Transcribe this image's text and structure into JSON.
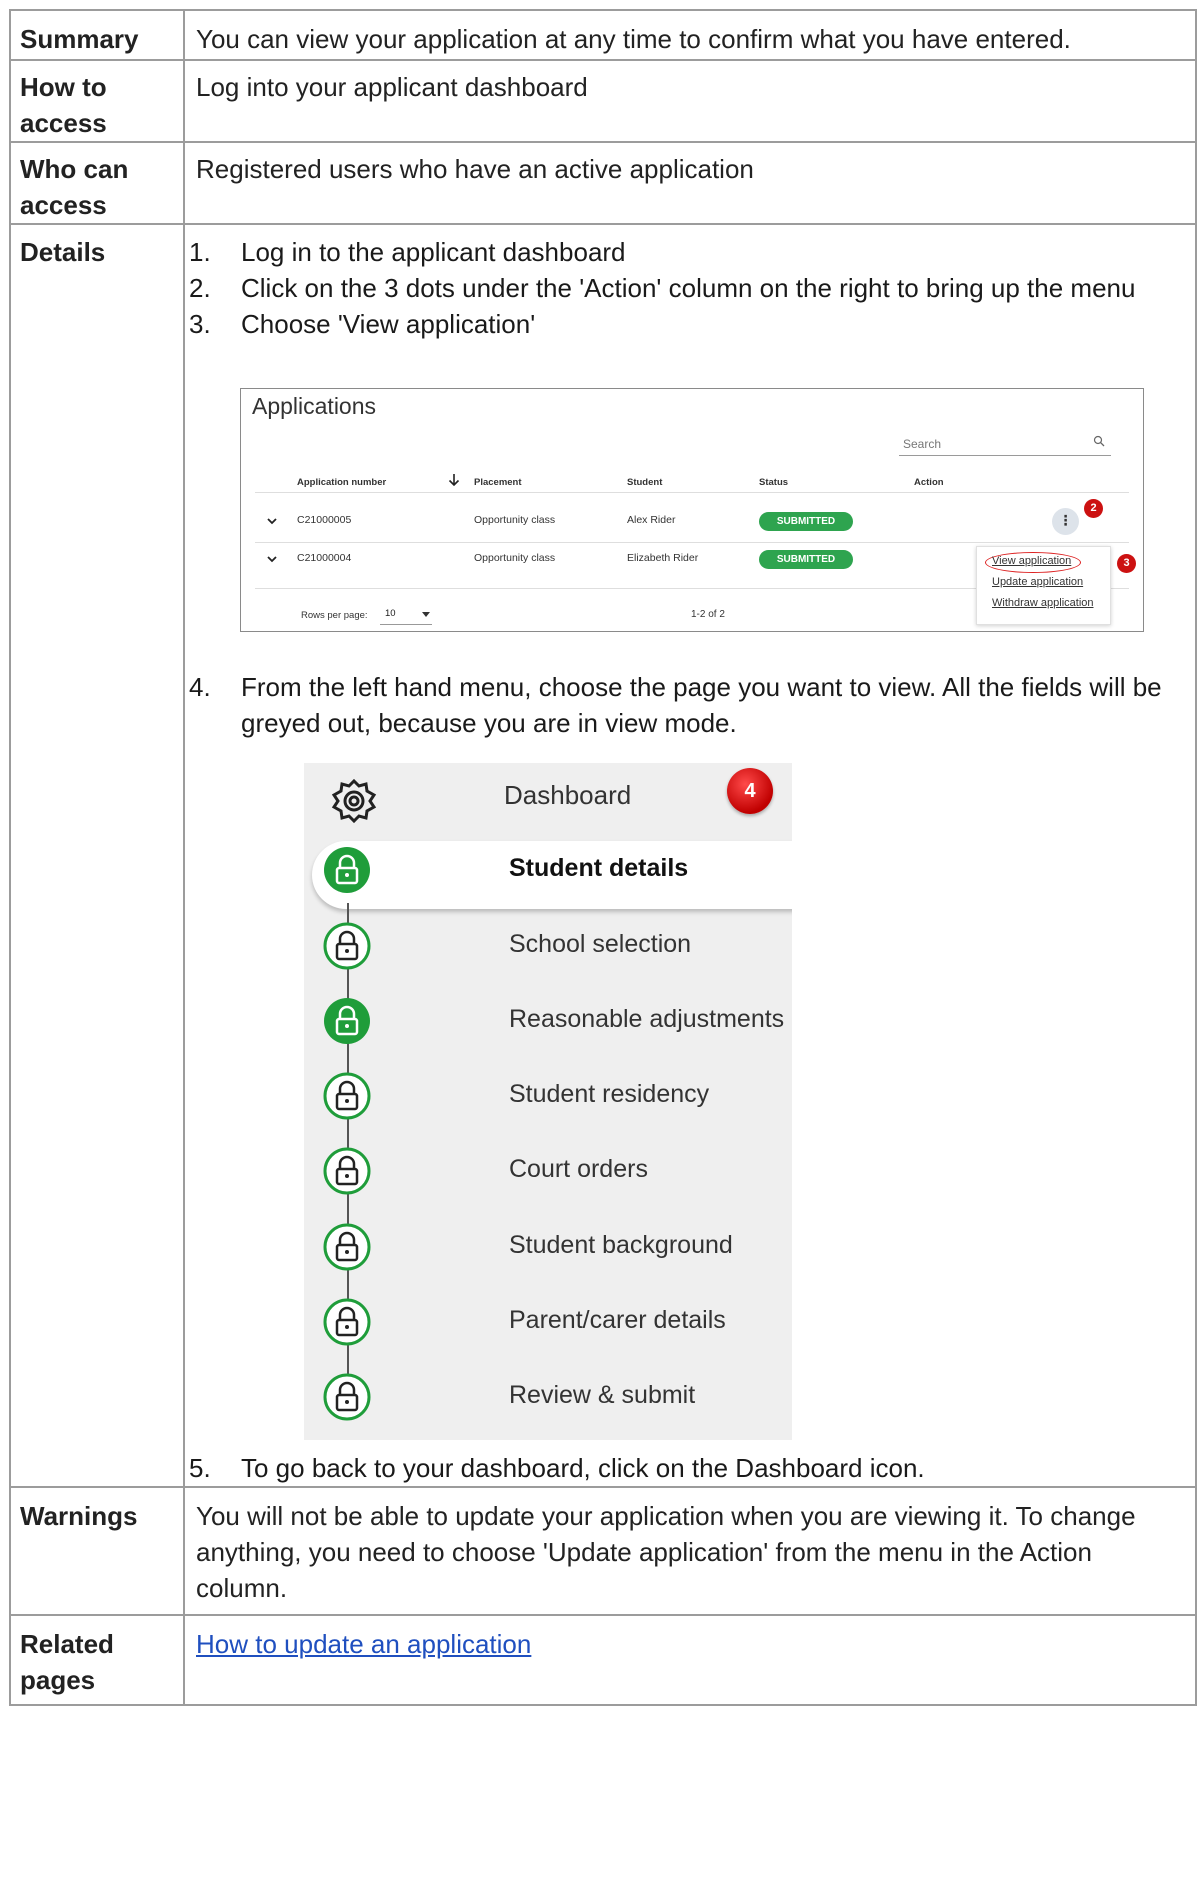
{
  "summary": {
    "label": "Summary",
    "text": "You can view your application at any time to confirm what you have entered."
  },
  "how_to_access": {
    "label": "How to access",
    "text": "Log into your applicant dashboard"
  },
  "who_can_access": {
    "label": "Who can access",
    "text": "Registered users who have an active application"
  },
  "details": {
    "label": "Details",
    "steps": [
      {
        "num": "1.",
        "text": "Log in to the applicant dashboard"
      },
      {
        "num": "2.",
        "text": "Click on the 3 dots under the 'Action' column on the right to bring up the menu"
      },
      {
        "num": "3.",
        "text": "Choose 'View application'"
      },
      {
        "num": "4.",
        "text": "From the left hand menu, choose the page you want to view. All the fields will be greyed out, because you are in view mode."
      },
      {
        "num": "5.",
        "text": "To go back to your dashboard, click on the Dashboard icon."
      }
    ]
  },
  "applications_screenshot": {
    "title": "Applications",
    "search_placeholder": "Search",
    "columns": [
      "Application number",
      "Placement",
      "Student",
      "Status",
      "Action"
    ],
    "rows": [
      {
        "number": "C21000005",
        "placement": "Opportunity class",
        "student": "Alex Rider",
        "status": "SUBMITTED"
      },
      {
        "number": "C21000004",
        "placement": "Opportunity class",
        "student": "Elizabeth Rider",
        "status": "SUBMITTED"
      }
    ],
    "action_dots": "⋮",
    "menu": [
      "View application",
      "Update application",
      "Withdraw application"
    ],
    "rows_per_page_label": "Rows per page:",
    "rows_per_page_value": "10",
    "pagination": "1-2 of 2",
    "markers": [
      "2",
      "3"
    ],
    "colors": {
      "submitted": "#2ea44f",
      "marker": "#cc1111"
    }
  },
  "nav_screenshot": {
    "dashboard_label": "Dashboard",
    "marker": "4",
    "items": [
      {
        "label": "Student details",
        "active": true,
        "filled": true
      },
      {
        "label": "School selection",
        "active": false,
        "filled": false
      },
      {
        "label": "Reasonable adjustments",
        "active": false,
        "filled": true
      },
      {
        "label": "Student residency",
        "active": false,
        "filled": false
      },
      {
        "label": "Court orders",
        "active": false,
        "filled": false
      },
      {
        "label": "Student background",
        "active": false,
        "filled": false
      },
      {
        "label": "Parent/carer details",
        "active": false,
        "filled": false
      },
      {
        "label": "Review & submit",
        "active": false,
        "filled": false
      }
    ],
    "icons": {
      "dashboard": "gear-icon",
      "step": "lock-icon"
    },
    "colors": {
      "green": "#1f9d3a"
    }
  },
  "warnings": {
    "label": "Warnings",
    "text": "You will not be able to update your application when you are viewing it. To change anything, you need to choose 'Update application' from the menu in the Action column."
  },
  "related_pages": {
    "label": "Related pages",
    "link_text": "How to update an application"
  }
}
